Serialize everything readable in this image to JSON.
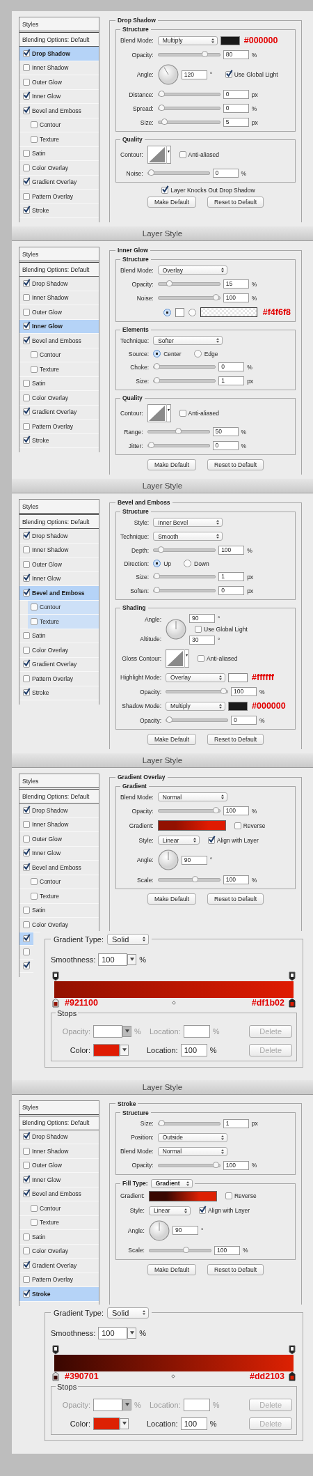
{
  "panels": [
    {
      "sidebar": {
        "header": "Styles",
        "blending": "Blending Options: Default",
        "items": [
          {
            "label": "Drop Shadow",
            "checked": true,
            "selected": true
          },
          {
            "label": "Inner Shadow",
            "checked": false,
            "selected": false
          },
          {
            "label": "Outer Glow",
            "checked": false,
            "selected": false
          },
          {
            "label": "Inner Glow",
            "checked": true,
            "selected": false
          },
          {
            "label": "Bevel and Emboss",
            "checked": true,
            "selected": false,
            "children": [
              {
                "label": "Contour",
                "checked": false,
                "selected": false
              },
              {
                "label": "Texture",
                "checked": false,
                "selected": false
              }
            ]
          },
          {
            "label": "Satin",
            "checked": false,
            "selected": false
          },
          {
            "label": "Color Overlay",
            "checked": false,
            "selected": false
          },
          {
            "label": "Gradient Overlay",
            "checked": true,
            "selected": false
          },
          {
            "label": "Pattern Overlay",
            "checked": false,
            "selected": false
          },
          {
            "label": "Stroke",
            "checked": true,
            "selected": false
          }
        ]
      },
      "section": {
        "title": "Drop Shadow",
        "groups": [
          {
            "title": "Structure",
            "rows": [
              {
                "kind": "select",
                "label": "Blend Mode:",
                "value": "Multiply",
                "color": "#1a1a1a",
                "note": "#000000"
              },
              {
                "kind": "slider",
                "label": "Opacity:",
                "level": 0.8,
                "value": "80",
                "unit": "%"
              },
              {
                "kind": "angle",
                "label": "Angle:",
                "value": "120",
                "unit": "°",
                "check": {
                  "label": "Use Global Light",
                  "checked": true
                }
              },
              {
                "kind": "slider",
                "label": "Distance:",
                "level": 0,
                "value": "0",
                "unit": "px"
              },
              {
                "kind": "slider",
                "label": "Spread:",
                "level": 0,
                "value": "0",
                "unit": "%"
              },
              {
                "kind": "slider",
                "label": "Size:",
                "level": 0.05,
                "value": "5",
                "unit": "px"
              }
            ]
          },
          {
            "title": "Quality",
            "rows": [
              {
                "kind": "contour",
                "label": "Contour:",
                "check": {
                  "label": "Anti-aliased",
                  "checked": false
                }
              },
              {
                "kind": "slider",
                "label": "Noise:",
                "level": 0,
                "value": "0",
                "unit": "%"
              }
            ]
          }
        ],
        "checks": [
          {
            "label": "Layer Knocks Out Drop Shadow",
            "checked": true
          }
        ],
        "buttons": [
          "Make Default",
          "Reset to Default"
        ]
      }
    },
    {
      "title": "Layer Style",
      "sidebar": {
        "header": "Styles",
        "blending": "Blending Options: Default",
        "items": [
          {
            "label": "Drop Shadow",
            "checked": true,
            "selected": false
          },
          {
            "label": "Inner Shadow",
            "checked": false,
            "selected": false
          },
          {
            "label": "Outer Glow",
            "checked": false,
            "selected": false
          },
          {
            "label": "Inner Glow",
            "checked": true,
            "selected": true
          },
          {
            "label": "Bevel and Emboss",
            "checked": true,
            "selected": false,
            "children": [
              {
                "label": "Contour",
                "checked": false,
                "selected": false
              },
              {
                "label": "Texture",
                "checked": false,
                "selected": false
              }
            ]
          },
          {
            "label": "Satin",
            "checked": false,
            "selected": false
          },
          {
            "label": "Color Overlay",
            "checked": false,
            "selected": false
          },
          {
            "label": "Gradient Overlay",
            "checked": true,
            "selected": false
          },
          {
            "label": "Pattern Overlay",
            "checked": false,
            "selected": false
          },
          {
            "label": "Stroke",
            "checked": true,
            "selected": false
          }
        ]
      },
      "section": {
        "title": "Inner Glow",
        "groups": [
          {
            "title": "Structure",
            "rows": [
              {
                "kind": "select",
                "label": "Blend Mode:",
                "value": "Overlay"
              },
              {
                "kind": "slider",
                "label": "Opacity:",
                "level": 0.15,
                "value": "15",
                "unit": "%"
              },
              {
                "kind": "slider",
                "label": "Noise:",
                "level": 1,
                "value": "100",
                "unit": "%"
              },
              {
                "kind": "glow",
                "options": [
                  {
                    "kind": "color",
                    "selected": true,
                    "color": "#ffffff"
                  },
                  {
                    "kind": "gradient",
                    "selected": false
                  }
                ],
                "note": "#f4f6f8"
              }
            ]
          },
          {
            "title": "Elements",
            "rows": [
              {
                "kind": "select",
                "label": "Technique:",
                "value": "Softer"
              },
              {
                "kind": "radio",
                "label": "Source:",
                "options": [
                  {
                    "label": "Center",
                    "selected": true
                  },
                  {
                    "label": "Edge",
                    "selected": false
                  }
                ]
              },
              {
                "kind": "slider",
                "label": "Choke:",
                "level": 0,
                "value": "0",
                "unit": "%"
              },
              {
                "kind": "slider",
                "label": "Size:",
                "level": 0,
                "value": "1",
                "unit": "px"
              }
            ]
          },
          {
            "title": "Quality",
            "rows": [
              {
                "kind": "contour",
                "label": "Contour:",
                "check": {
                  "label": "Anti-aliased",
                  "checked": false
                }
              },
              {
                "kind": "slider",
                "label": "Range:",
                "level": 0.5,
                "value": "50",
                "unit": "%"
              },
              {
                "kind": "slider",
                "label": "Jitter:",
                "level": 0,
                "value": "0",
                "unit": "%"
              }
            ]
          }
        ],
        "buttons": [
          "Make Default",
          "Reset to Default"
        ]
      }
    },
    {
      "title": "Layer Style",
      "sidebar": {
        "header": "Styles",
        "blending": "Blending Options: Default",
        "items": [
          {
            "label": "Drop Shadow",
            "checked": true,
            "selected": false
          },
          {
            "label": "Inner Shadow",
            "checked": false,
            "selected": false
          },
          {
            "label": "Outer Glow",
            "checked": false,
            "selected": false
          },
          {
            "label": "Inner Glow",
            "checked": true,
            "selected": false
          },
          {
            "label": "Bevel and Emboss",
            "checked": true,
            "selected": true,
            "children": [
              {
                "label": "Contour",
                "checked": false,
                "selected": true
              },
              {
                "label": "Texture",
                "checked": false,
                "selected": true
              }
            ]
          },
          {
            "label": "Satin",
            "checked": false,
            "selected": false
          },
          {
            "label": "Color Overlay",
            "checked": false,
            "selected": false
          },
          {
            "label": "Gradient Overlay",
            "checked": true,
            "selected": false
          },
          {
            "label": "Pattern Overlay",
            "checked": false,
            "selected": false
          },
          {
            "label": "Stroke",
            "checked": true,
            "selected": false
          }
        ]
      },
      "section": {
        "title": "Bevel and Emboss",
        "groups": [
          {
            "title": "Structure",
            "rows": [
              {
                "kind": "select",
                "label": "Style:",
                "value": "Inner Bevel"
              },
              {
                "kind": "select",
                "label": "Technique:",
                "value": "Smooth"
              },
              {
                "kind": "slider",
                "label": "Depth:",
                "level": 0.08,
                "value": "100",
                "unit": "%"
              },
              {
                "kind": "radio",
                "label": "Direction:",
                "options": [
                  {
                    "label": "Up",
                    "selected": true
                  },
                  {
                    "label": "Down",
                    "selected": false
                  }
                ]
              },
              {
                "kind": "slider",
                "label": "Size:",
                "level": 0,
                "value": "1",
                "unit": "px"
              },
              {
                "kind": "slider",
                "label": "Soften:",
                "level": 0,
                "value": "0",
                "unit": "px"
              }
            ]
          },
          {
            "title": "Shading",
            "rows": [
              {
                "kind": "angle_altitude",
                "label": "Angle:",
                "value": "90",
                "unit": "°",
                "check": {
                  "label": "Use Global Light",
                  "checked": false
                },
                "label2": "Altitude:",
                "value2": "30",
                "unit2": "°"
              },
              {
                "kind": "contour",
                "label": "Gloss Contour:",
                "check": {
                  "label": "Anti-aliased",
                  "checked": false
                }
              },
              {
                "kind": "select",
                "label": "Highlight Mode:",
                "value": "Overlay",
                "color": "#fefefe",
                "note": "#ffffff"
              },
              {
                "kind": "slider",
                "label": "Opacity:",
                "level": 1,
                "value": "100",
                "unit": "%"
              },
              {
                "kind": "select",
                "label": "Shadow Mode:",
                "value": "Multiply",
                "color": "#1a1a1a",
                "note": "#000000"
              },
              {
                "kind": "slider",
                "label": "Opacity:",
                "level": 0,
                "value": "0",
                "unit": "%"
              }
            ]
          }
        ],
        "buttons": [
          "Make Default",
          "Reset to Default"
        ]
      }
    },
    {
      "title": "Layer Style",
      "sidebar": {
        "header": "Styles",
        "blending": "Blending Options: Default",
        "items": [
          {
            "label": "Drop Shadow",
            "checked": true,
            "selected": false
          },
          {
            "label": "Inner Shadow",
            "checked": false,
            "selected": false
          },
          {
            "label": "Outer Glow",
            "checked": false,
            "selected": false
          },
          {
            "label": "Inner Glow",
            "checked": true,
            "selected": false
          },
          {
            "label": "Bevel and Emboss",
            "checked": true,
            "selected": false,
            "children": [
              {
                "label": "Contour",
                "checked": false,
                "selected": false
              },
              {
                "label": "Texture",
                "checked": false,
                "selected": false
              }
            ]
          },
          {
            "label": "Satin",
            "checked": false,
            "selected": false
          },
          {
            "label": "Color Overlay",
            "checked": false,
            "selected": false
          },
          {
            "checked": true,
            "selected": true
          },
          {
            "checked": false,
            "selected": false
          },
          {
            "checked": true,
            "selected": false
          }
        ]
      },
      "section": {
        "title": "Gradient Overlay",
        "groups": [
          {
            "title": "Gradient",
            "rows": [
              {
                "kind": "select",
                "label": "Blend Mode:",
                "value": "Normal"
              },
              {
                "kind": "slider",
                "label": "Opacity:",
                "level": 1,
                "value": "100",
                "unit": "%"
              },
              {
                "kind": "gradient",
                "label": "Gradient:",
                "stops": [
                  {
                    "color": "#921100"
                  },
                  {
                    "color": "#df1b02"
                  }
                ],
                "check": {
                  "label": "Reverse",
                  "checked": false
                }
              },
              {
                "kind": "select",
                "label": "Style:",
                "value": "Linear",
                "check": {
                  "label": "Align with Layer",
                  "checked": true
                }
              },
              {
                "kind": "angle",
                "label": "Angle:",
                "value": "90",
                "unit": "°"
              },
              {
                "kind": "slider",
                "label": "Scale:",
                "level": 0.62,
                "value": "100",
                "unit": "%"
              }
            ]
          }
        ],
        "buttons": [
          "Make Default",
          "Reset to Default"
        ]
      },
      "editor": {
        "type_label": "Gradient Type:",
        "type_value": "Solid",
        "smoothness_label": "Smoothness:",
        "smoothness": "100",
        "smoothness_unit": "%",
        "stops": [
          {
            "color": "#921100"
          },
          {
            "color": "#df1b02"
          }
        ],
        "notes": [
          "#921100",
          "#df1b02"
        ],
        "stops_title": "Stops",
        "stop_rows": [
          {
            "kind": "opacity",
            "label": "Opacity:",
            "unit": "%",
            "location_label": "Location:",
            "location_unit": "%",
            "button": "Delete",
            "disabled": true
          },
          {
            "kind": "color",
            "label": "Color:",
            "color": "#df1b02",
            "location_label": "Location:",
            "location": "100",
            "location_unit": "%",
            "button": "Delete",
            "disabled": false
          }
        ]
      }
    },
    {
      "title": "Layer Style",
      "sidebar": {
        "header": "Styles",
        "blending": "Blending Options: Default",
        "items": [
          {
            "label": "Drop Shadow",
            "checked": true,
            "selected": false
          },
          {
            "label": "Inner Shadow",
            "checked": false,
            "selected": false
          },
          {
            "label": "Outer Glow",
            "checked": false,
            "selected": false
          },
          {
            "label": "Inner Glow",
            "checked": true,
            "selected": false
          },
          {
            "label": "Bevel and Emboss",
            "checked": true,
            "selected": false,
            "children": [
              {
                "label": "Contour",
                "checked": false,
                "selected": false
              },
              {
                "label": "Texture",
                "checked": false,
                "selected": false
              }
            ]
          },
          {
            "label": "Satin",
            "checked": false,
            "selected": false
          },
          {
            "label": "Color Overlay",
            "checked": false,
            "selected": false
          },
          {
            "label": "Gradient Overlay",
            "checked": true,
            "selected": false
          },
          {
            "label": "Pattern Overlay",
            "checked": false,
            "selected": false
          },
          {
            "label": "Stroke",
            "checked": true,
            "selected": true
          }
        ]
      },
      "section": {
        "title": "Stroke",
        "groups": [
          {
            "title": "Structure",
            "rows": [
              {
                "kind": "slider",
                "label": "Size:",
                "level": 0,
                "value": "1",
                "unit": "px"
              },
              {
                "kind": "select",
                "label": "Position:",
                "value": "Outside"
              },
              {
                "kind": "select",
                "label": "Blend Mode:",
                "value": "Normal"
              },
              {
                "kind": "slider",
                "label": "Opacity:",
                "level": 1,
                "value": "100",
                "unit": "%"
              }
            ]
          },
          {
            "title": "Fill Type:",
            "select": "Gradient",
            "rows": [
              {
                "kind": "gradient",
                "label": "Gradient:",
                "stops": [
                  {
                    "color": "#390701"
                  },
                  {
                    "color": "#dd2103"
                  }
                ],
                "check": {
                  "label": "Reverse",
                  "checked": false
                }
              },
              {
                "kind": "select",
                "label": "Style:",
                "value": "Linear",
                "check": {
                  "label": "Align with Layer",
                  "checked": true
                }
              },
              {
                "kind": "angle",
                "label": "Angle:",
                "value": "90",
                "unit": "°"
              },
              {
                "kind": "slider",
                "label": "Scale:",
                "level": 0.62,
                "value": "100",
                "unit": "%"
              }
            ]
          }
        ],
        "buttons": [
          "Make Default",
          "Reset to Default"
        ]
      },
      "editor": {
        "type_label": "Gradient Type:",
        "type_value": "Solid",
        "smoothness_label": "Smoothness:",
        "smoothness": "100",
        "smoothness_unit": "%",
        "stops": [
          {
            "color": "#390701"
          },
          {
            "color": "#dd2103"
          }
        ],
        "notes": [
          "#390701",
          "#dd2103"
        ],
        "stops_title": "Stops",
        "stop_rows": [
          {
            "kind": "opacity",
            "label": "Opacity:",
            "unit": "%",
            "location_label": "Location:",
            "location_unit": "%",
            "button": "Delete",
            "disabled": true
          },
          {
            "kind": "color",
            "label": "Color:",
            "color": "#dd2103",
            "location_label": "Location:",
            "location": "100",
            "location_unit": "%",
            "button": "Delete",
            "disabled": false
          }
        ]
      }
    }
  ]
}
